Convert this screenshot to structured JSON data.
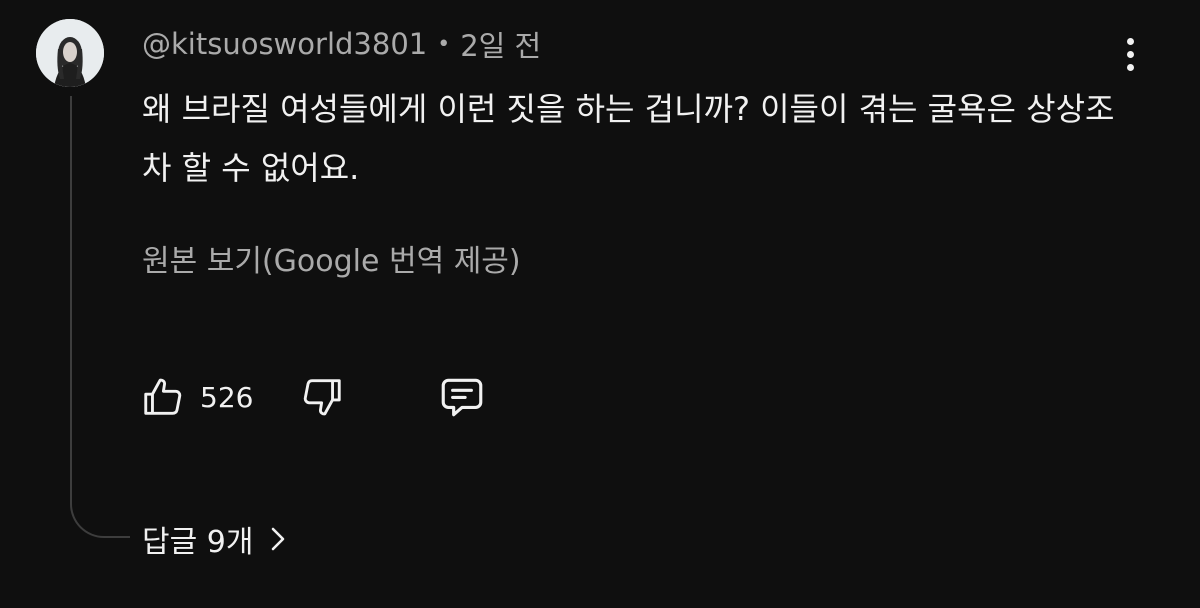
{
  "comment": {
    "author": "@kitsuosworld3801",
    "separator": "•",
    "time": "2일 전",
    "text": "왜 브라질 여성들에게 이런 짓을 하는 겁니까? 이들이 겪는 굴욕은 상상조차 할 수 없어요.",
    "translate_link": "원본 보기(Google 번역 제공)",
    "like_count": "526",
    "replies_label": "답글 9개"
  },
  "icons": {
    "more": "more-vertical-icon",
    "like": "thumbs-up-icon",
    "dislike": "thumbs-down-icon",
    "reply": "comment-icon",
    "expand": "chevron-right-icon"
  },
  "colors": {
    "background": "#0f0f0f",
    "primary_text": "#f1f1f1",
    "secondary_text": "#aaaaaa",
    "thread_line": "#3d3d3d"
  }
}
